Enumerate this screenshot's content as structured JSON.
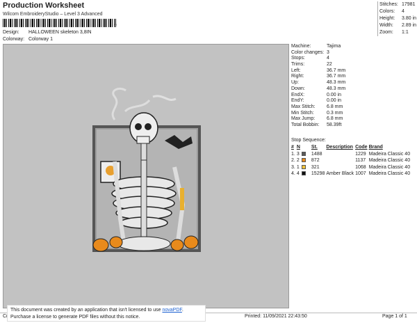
{
  "header": {
    "title": "Production Worksheet",
    "software": "Wilcom EmbroideryStudio – Level 3 Advanced",
    "barcode_tail": ",",
    "design_label": "Design:",
    "design_value": "HALLOWEEN skeleton 3,8IN",
    "colorway_label": "Colorway:",
    "colorway_value": "Colorway 1"
  },
  "stats": [
    {
      "label": "Stitches:",
      "value": "17981"
    },
    {
      "label": "Colors:",
      "value": "4"
    },
    {
      "label": "Height:",
      "value": "3.80 in"
    },
    {
      "label": "Width:",
      "value": "2.89 in"
    },
    {
      "label": "Zoom:",
      "value": "1:1"
    }
  ],
  "machine_info": [
    {
      "label": "Machine:",
      "value": "Tajima"
    },
    {
      "label": "Color changes:",
      "value": "3"
    },
    {
      "label": "Stops:",
      "value": "4"
    },
    {
      "label": "Trims:",
      "value": "22"
    },
    {
      "label": "Left:",
      "value": "36.7 mm"
    },
    {
      "label": "Right:",
      "value": "36.7 mm"
    },
    {
      "label": "Up:",
      "value": "48.3 mm"
    },
    {
      "label": "Down:",
      "value": "48.3 mm"
    },
    {
      "label": "EndX:",
      "value": "0.00 in"
    },
    {
      "label": "EndY:",
      "value": "0.00 in"
    },
    {
      "label": "Max Stitch:",
      "value": "6.8 mm"
    },
    {
      "label": "Min Stitch:",
      "value": "0.3 mm"
    },
    {
      "label": "Max Jump:",
      "value": "6.8 mm"
    },
    {
      "label": "Total Bobbin:",
      "value": "58.39ft"
    }
  ],
  "stop_sequence": {
    "title": "Stop Sequence:",
    "headers": [
      "#",
      "N",
      "",
      "St.",
      "Description",
      "Code",
      "Brand"
    ],
    "rows": [
      {
        "num": "1.",
        "n": "3",
        "color": "#5a5a5a",
        "st": "1488",
        "desc": "",
        "code": "1229",
        "brand": "Madeira Classic 40"
      },
      {
        "num": "2.",
        "n": "2",
        "color": "#e88a1c",
        "st": "872",
        "desc": "",
        "code": "1137",
        "brand": "Madeira Classic 40"
      },
      {
        "num": "3.",
        "n": "1",
        "color": "#f0c23a",
        "st": "321",
        "desc": "",
        "code": "1068",
        "brand": "Madeira Classic 40"
      },
      {
        "num": "4.",
        "n": "4",
        "color": "#111111",
        "st": "15298",
        "desc": "Amber Black",
        "code": "1007",
        "brand": "Madeira Classic 40"
      }
    ]
  },
  "footer": {
    "left": "Cr",
    "printed": "Printed: 11/09/2021 22:43:50",
    "page": "Page 1 of 1"
  },
  "banner": {
    "line1": "This document was created by an application that isn't licensed to use ",
    "link": "novaPDF",
    "line1_end": ".",
    "line2": "Purchase a license to generate PDF files without this notice."
  }
}
